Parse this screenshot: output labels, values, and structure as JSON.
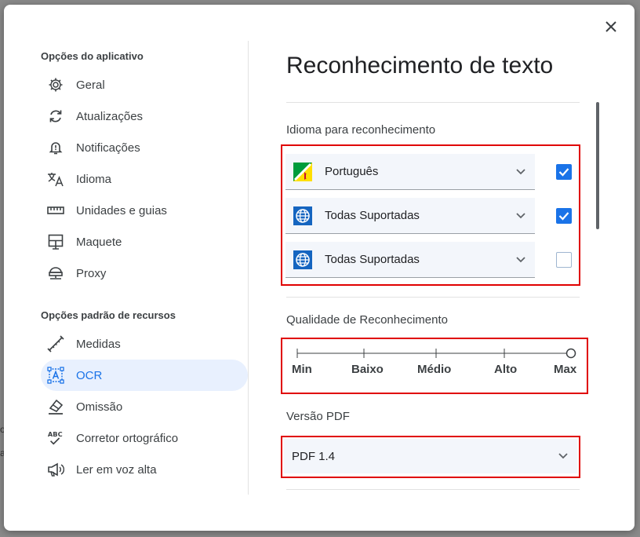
{
  "backdrop": {
    "line1": "o",
    "line2": "a"
  },
  "sidebar": {
    "app_options_title": "Opções do aplicativo",
    "app_items": [
      {
        "label": "Geral",
        "icon": "gear-icon"
      },
      {
        "label": "Atualizações",
        "icon": "sync-icon"
      },
      {
        "label": "Notificações",
        "icon": "bell-alert-icon"
      },
      {
        "label": "Idioma",
        "icon": "translate-icon"
      },
      {
        "label": "Unidades e guias",
        "icon": "ruler-icon"
      },
      {
        "label": "Maquete",
        "icon": "layout-icon"
      },
      {
        "label": "Proxy",
        "icon": "network-icon"
      }
    ],
    "resource_options_title": "Opções padrão de recursos",
    "resource_items": [
      {
        "label": "Medidas",
        "icon": "measure-icon"
      },
      {
        "label": "OCR",
        "icon": "ocr-icon",
        "active": true
      },
      {
        "label": "Omissão",
        "icon": "eraser-icon"
      },
      {
        "label": "Corretor ortográfico",
        "icon": "spellcheck-icon"
      },
      {
        "label": "Ler em voz alta",
        "icon": "megaphone-icon"
      }
    ]
  },
  "main": {
    "title": "Reconhecimento de texto",
    "language_section": {
      "label": "Idioma para reconhecimento",
      "rows": [
        {
          "value": "Português",
          "icon": "brazil-flag-icon",
          "checked": true
        },
        {
          "value": "Todas Suportadas",
          "icon": "globe-icon",
          "checked": true
        },
        {
          "value": "Todas Suportadas",
          "icon": "globe-icon",
          "checked": false
        }
      ]
    },
    "quality_section": {
      "label": "Qualidade de Reconhecimento",
      "levels": [
        "Min",
        "Baixo",
        "Médio",
        "Alto",
        "Max"
      ],
      "selected": "Max"
    },
    "pdf_section": {
      "label": "Versão PDF",
      "value": "PDF 1.4"
    }
  },
  "colors": {
    "accent": "#1a73e8",
    "highlight_border": "#e00000",
    "active_bg": "#e8f0fe"
  }
}
